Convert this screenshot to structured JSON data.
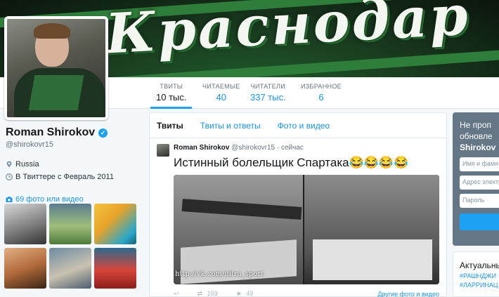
{
  "banner": {
    "text": "Краснодар"
  },
  "nav": {
    "stats": [
      {
        "label": "ТВИТЫ",
        "value": "10 тыс."
      },
      {
        "label": "ЧИТАЕМЫЕ",
        "value": "40"
      },
      {
        "label": "ЧИТАТЕЛИ",
        "value": "337 тыс."
      },
      {
        "label": "ИЗБРАННОЕ",
        "value": "6"
      }
    ]
  },
  "profile": {
    "name": "Roman Shirokov",
    "handle": "@shirokovr15",
    "location": "Russia",
    "joined": "В Твиттере с Февраль 2011",
    "photos_link": "69 фото или видео"
  },
  "timeline": {
    "tabs": [
      "Твиты",
      "Твиты и ответы",
      "Фото и видео"
    ],
    "tweet": {
      "name": "Roman Shirokov",
      "handle": "@shirokovr15",
      "time": "· сейчас",
      "text": "Истинный болельщик Спартака😂😂😂😂",
      "media_caption": "http://vk.com/ultra_sport",
      "retweets": "159",
      "likes": "49",
      "more_link": "Другие фото и видео"
    }
  },
  "signup": {
    "title": "Не проп обновле",
    "name": "Shirokov",
    "name_placeholder": "Имя и фами",
    "email_placeholder": "Адрес электр",
    "password_placeholder": "Пароль"
  },
  "trends": {
    "title": "Актуальные",
    "items": [
      "#РАШНДЖИ",
      "#ЛАРРИНАЦ"
    ]
  }
}
